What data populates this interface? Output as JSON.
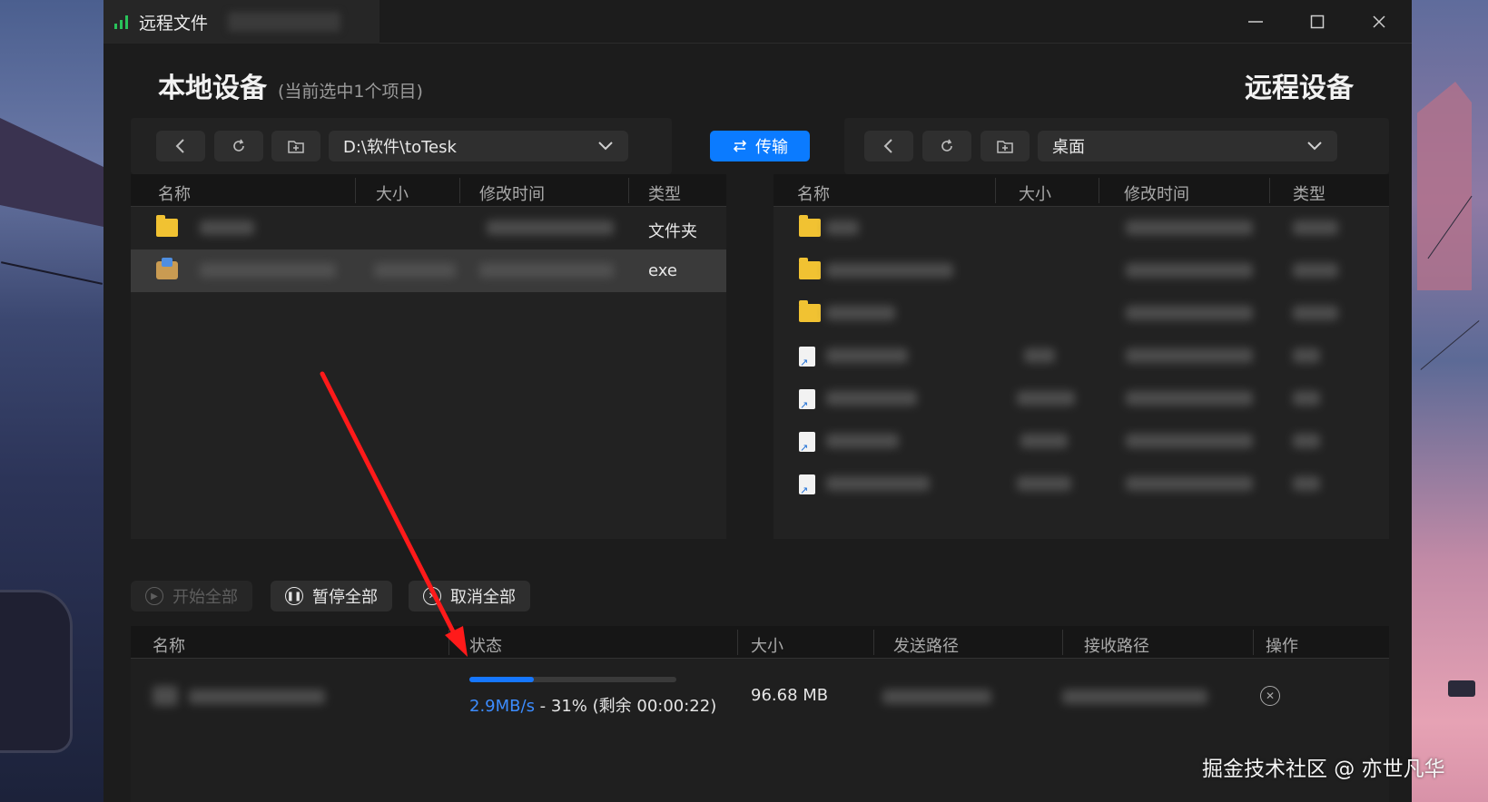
{
  "window": {
    "title": "远程文件"
  },
  "local": {
    "heading": "本地设备",
    "selection_note": "(当前选中1个项目)",
    "path": "D:\\软件\\toTesk",
    "columns": [
      "名称",
      "大小",
      "修改时间",
      "类型"
    ],
    "files": [
      {
        "icon": "folder-icon",
        "type": "文件夹",
        "selected": false
      },
      {
        "icon": "exe-icon",
        "type": "exe",
        "selected": true
      }
    ]
  },
  "transfer_button": "传输",
  "remote": {
    "heading": "远程设备",
    "path": "桌面",
    "columns": [
      "名称",
      "大小",
      "修改时间",
      "类型"
    ],
    "files": [
      {
        "icon": "folder-icon"
      },
      {
        "icon": "folder-icon"
      },
      {
        "icon": "folder-icon"
      },
      {
        "icon": "shortcut-icon"
      },
      {
        "icon": "shortcut-icon"
      },
      {
        "icon": "shortcut-icon"
      },
      {
        "icon": "shortcut-icon"
      }
    ]
  },
  "queue": {
    "buttons": {
      "start_all": "开始全部",
      "pause_all": "暂停全部",
      "cancel_all": "取消全部"
    },
    "columns": [
      "名称",
      "状态",
      "大小",
      "发送路径",
      "接收路径",
      "操作"
    ],
    "items": [
      {
        "progress_percent": 31,
        "speed": "2.9MB/s",
        "status_rest": " - 31% (剩余 00:00:22)",
        "size": "96.68 MB"
      }
    ]
  },
  "watermark": "掘金技术社区 @ 亦世凡华",
  "colors": {
    "accent": "#0b7bff",
    "signal": "#29c35a",
    "annotation_arrow": "#ff1a1a"
  }
}
